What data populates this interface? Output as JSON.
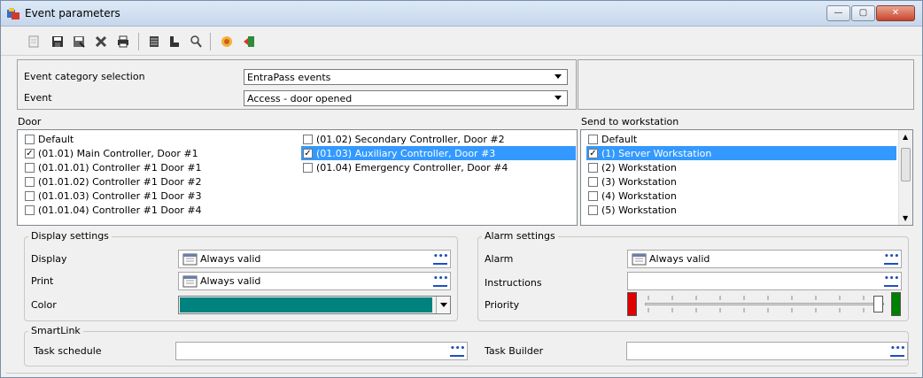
{
  "window": {
    "title": "Event parameters",
    "minimize": "▭",
    "maximize": "▢",
    "close": "✕"
  },
  "toolbar": {
    "icons": [
      "new-icon",
      "save-icon",
      "save-as-icon",
      "delete-icon",
      "print-icon",
      "list-icon",
      "link-icon",
      "search-icon",
      "reload-icon",
      "exit-icon"
    ]
  },
  "selection": {
    "category_label": "Event category selection",
    "category_value": "EntraPass events",
    "event_label": "Event",
    "event_value": "Access - door opened"
  },
  "door": {
    "label": "Door",
    "items": [
      {
        "text": "Default",
        "checked": false
      },
      {
        "text": "(01.01) Main Controller, Door #1",
        "checked": true
      },
      {
        "text": "(01.01.01) Controller #1 Door #1",
        "checked": false
      },
      {
        "text": "(01.01.02) Controller #1 Door #2",
        "checked": false
      },
      {
        "text": "(01.01.03) Controller #1 Door #3",
        "checked": false
      },
      {
        "text": "(01.01.04) Controller #1 Door #4",
        "checked": false
      },
      {
        "text": "(01.02) Secondary Controller, Door #2",
        "checked": false
      },
      {
        "text": "(01.03) Auxiliary Controller, Door #3",
        "checked": true,
        "selected": true
      },
      {
        "text": "(01.04) Emergency Controller, Door #4",
        "checked": false
      }
    ]
  },
  "workstation": {
    "label": "Send to workstation",
    "items": [
      {
        "text": "Default",
        "checked": false
      },
      {
        "text": "(1) Server Workstation",
        "checked": true,
        "selected": true
      },
      {
        "text": "(2) Workstation",
        "checked": false
      },
      {
        "text": "(3) Workstation",
        "checked": false
      },
      {
        "text": "(4) Workstation",
        "checked": false
      },
      {
        "text": "(5) Workstation",
        "checked": false
      }
    ]
  },
  "display_settings": {
    "title": "Display settings",
    "display_label": "Display",
    "display_value": "Always valid",
    "print_label": "Print",
    "print_value": "Always valid",
    "color_label": "Color",
    "color_value": "#00827f"
  },
  "alarm_settings": {
    "title": "Alarm settings",
    "alarm_label": "Alarm",
    "alarm_value": "Always valid",
    "instructions_label": "Instructions",
    "instructions_value": "",
    "priority_label": "Priority",
    "priority_low_color": "#e00000",
    "priority_high_color": "#008000"
  },
  "smartlink": {
    "title": "SmartLink",
    "task_schedule_label": "Task schedule",
    "task_schedule_value": "",
    "task_builder_label": "Task Builder",
    "task_builder_value": ""
  },
  "ellipsis": "•••"
}
